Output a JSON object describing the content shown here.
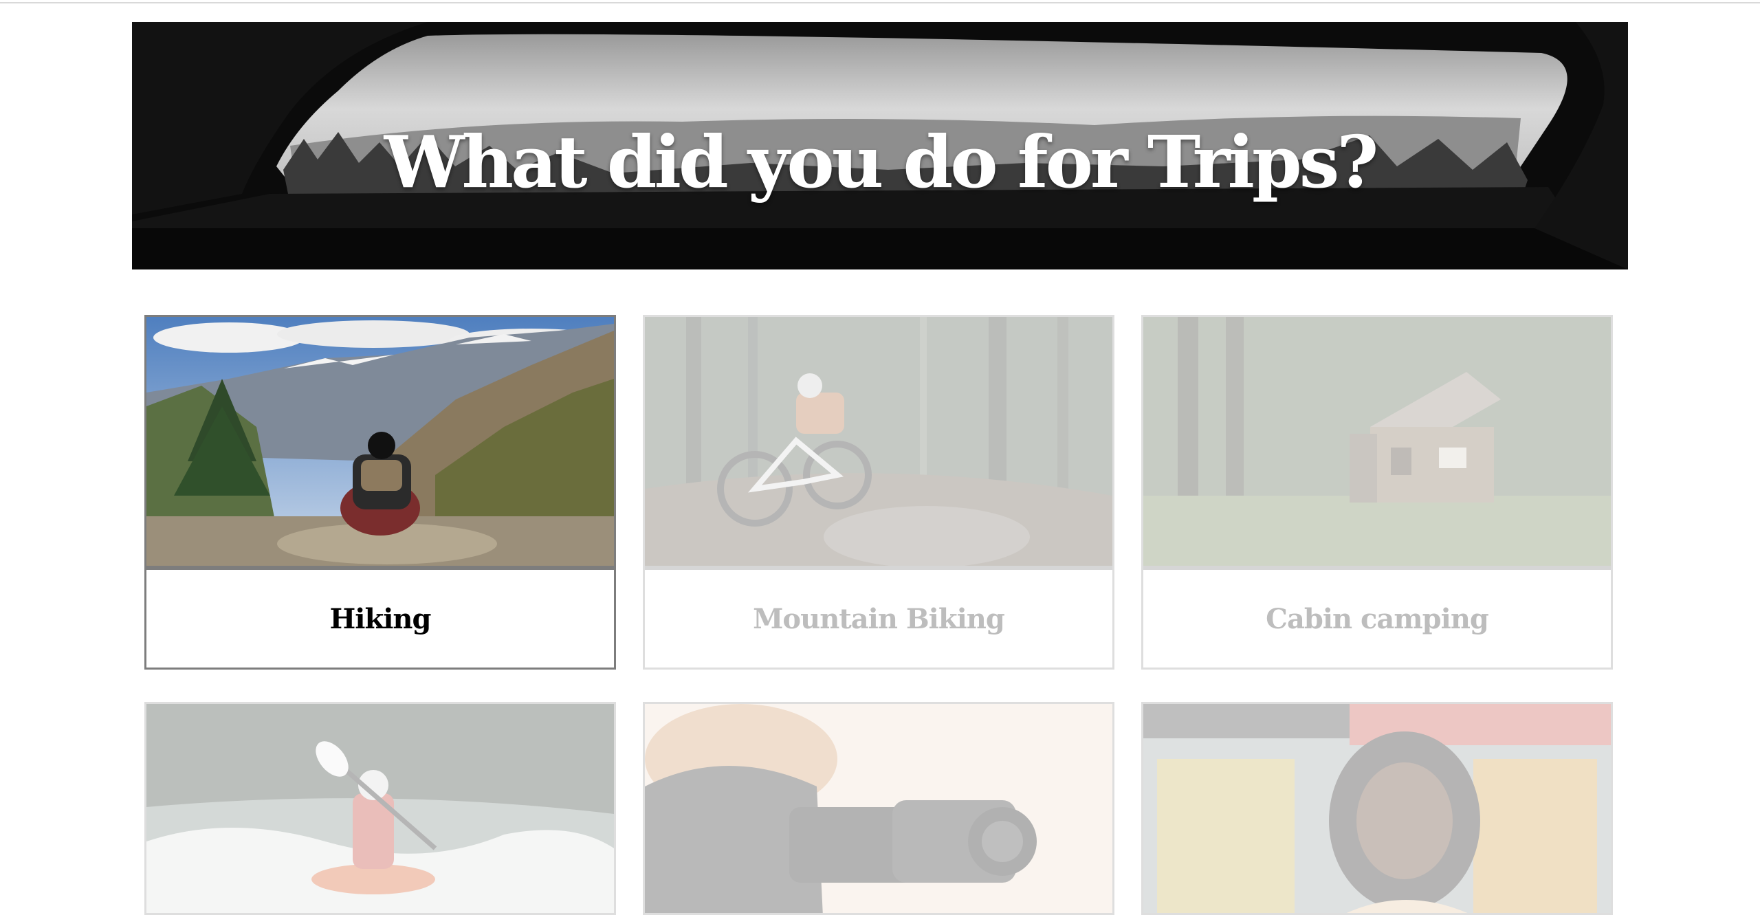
{
  "hero": {
    "title": "What did you do for Trips?"
  },
  "activities": [
    {
      "label": "Hiking",
      "image": "hiker-on-mountain-photo",
      "selected": true
    },
    {
      "label": "Mountain Biking",
      "image": "mountain-biker-in-forest-photo",
      "selected": false
    },
    {
      "label": "Cabin camping",
      "image": "log-cabin-in-woods-photo",
      "selected": false
    },
    {
      "label": "",
      "image": "kayaker-in-rapids-photo",
      "selected": false
    },
    {
      "label": "",
      "image": "photographer-with-camera-photo",
      "selected": false
    },
    {
      "label": "",
      "image": "woman-laughing-in-shop-photo",
      "selected": false
    }
  ],
  "colors": {
    "selected_border": "#7d7d7d",
    "unselected_border": "#dedede",
    "unselected_text": "#bdbdbd",
    "selected_text": "#000000"
  }
}
